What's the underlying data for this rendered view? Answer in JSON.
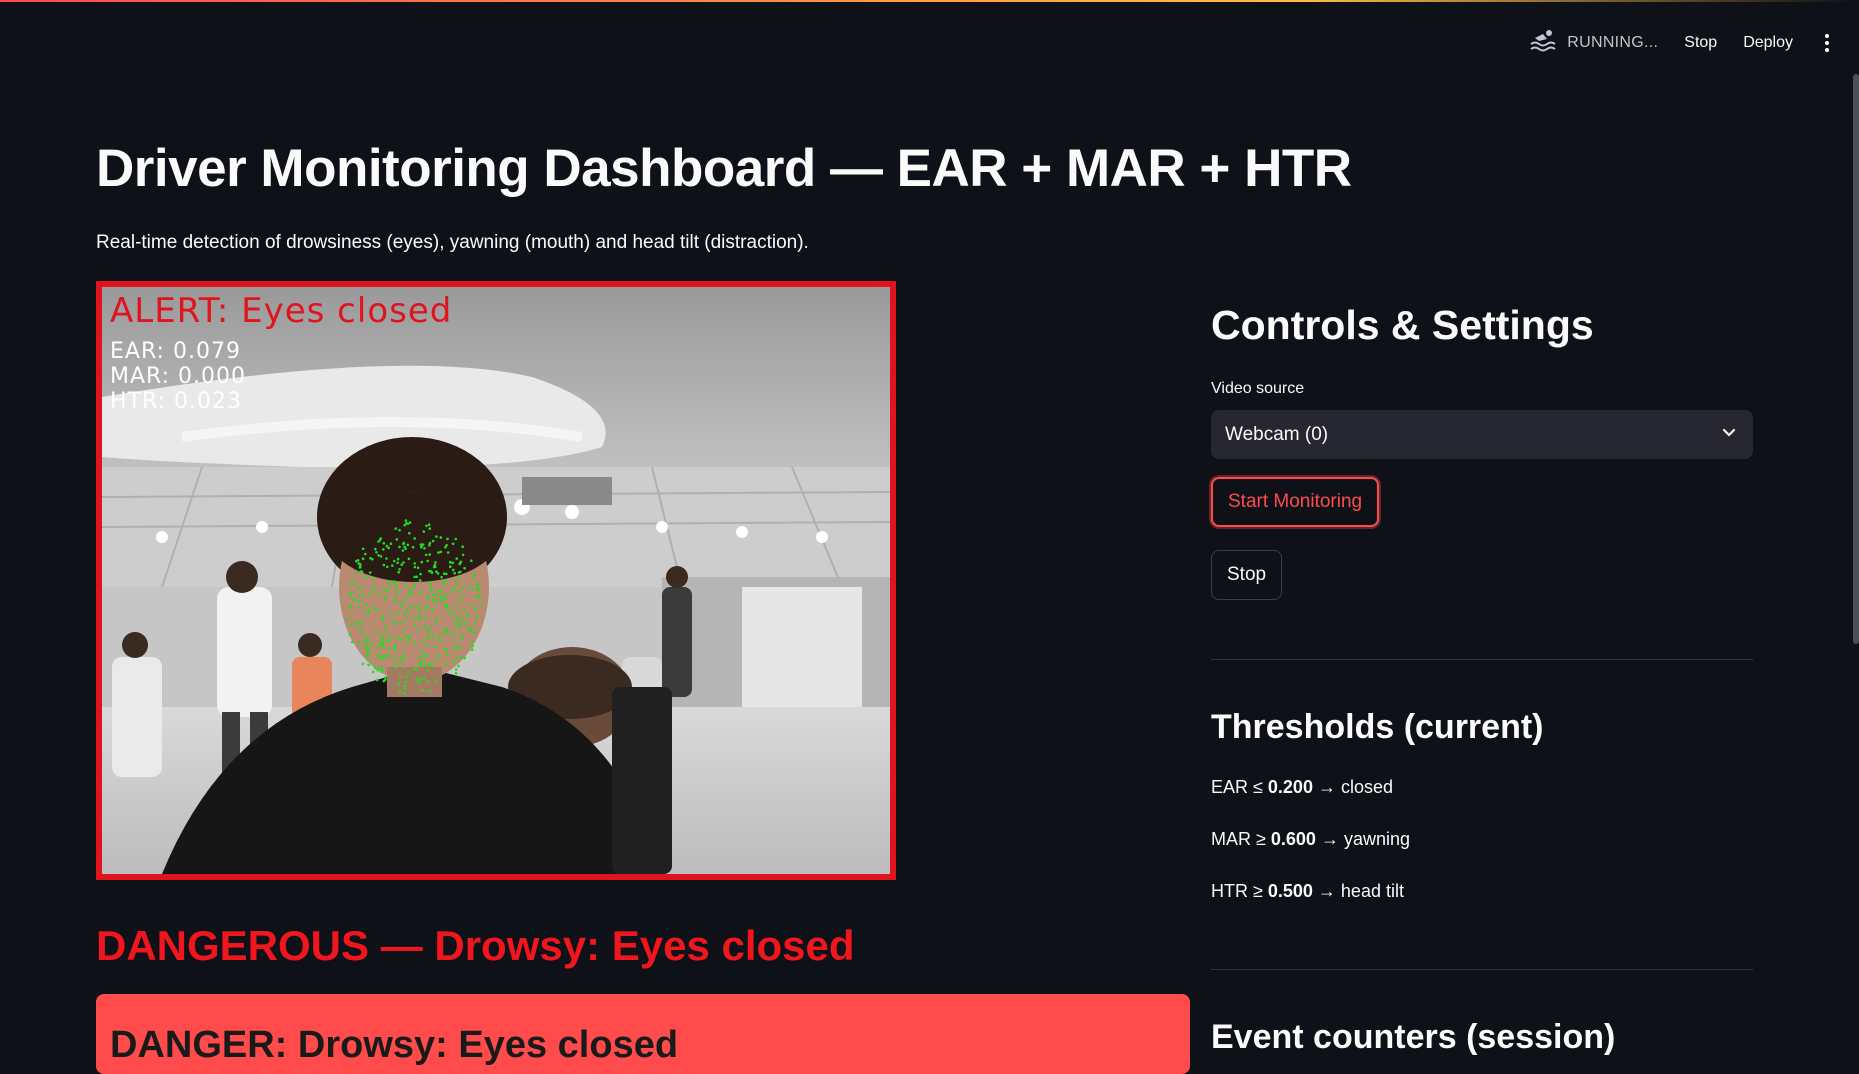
{
  "toolbar": {
    "status_text": "RUNNING...",
    "stop_label": "Stop",
    "deploy_label": "Deploy"
  },
  "header": {
    "title": "Driver Monitoring Dashboard — EAR + MAR + HTR",
    "subtitle": "Real-time detection of drowsiness (eyes), yawning (mouth) and head tilt (distraction)."
  },
  "video": {
    "alert_text": "ALERT: Eyes closed",
    "ear_text": "EAR: 0.079",
    "mar_text": "MAR: 0.000",
    "htr_text": "HTR: 0.023"
  },
  "status": {
    "heading": "DANGEROUS — Drowsy: Eyes closed",
    "banner_text": "DANGER: Drowsy: Eyes closed"
  },
  "controls": {
    "heading": "Controls & Settings",
    "video_source_label": "Video source",
    "video_source_value": "Webcam (0)",
    "start_label": "Start Monitoring",
    "stop_label": "Stop"
  },
  "thresholds": {
    "heading": "Thresholds (current)",
    "ear": {
      "prefix": "EAR ≤ ",
      "value": "0.200",
      "suffix": " → closed"
    },
    "mar": {
      "prefix": "MAR ≥ ",
      "value": "0.600",
      "suffix": " → yawning"
    },
    "htr": {
      "prefix": "HTR ≥ ",
      "value": "0.500",
      "suffix": " → head tilt"
    }
  },
  "events": {
    "heading": "Event counters (session)"
  },
  "colors": {
    "background": "#0e1117",
    "accent": "#ff4b4b",
    "alert_red": "#e0141e",
    "landmark_green": "#22dd22"
  }
}
